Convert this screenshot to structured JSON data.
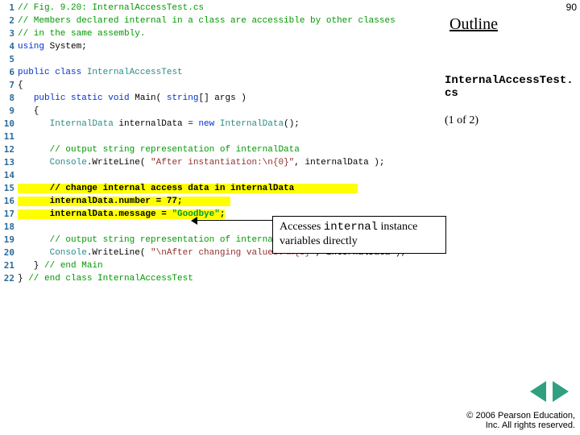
{
  "slide": {
    "page_number": "90",
    "outline_label": "Outline",
    "file_label_line1": "InternalAccessTest.",
    "file_label_line2": "cs",
    "page_indicator": "(1 of 2)"
  },
  "code": [
    {
      "n": "1",
      "segs": [
        {
          "c": "tok-comment",
          "t": "// Fig. 9.20: InternalAccessTest.cs"
        }
      ]
    },
    {
      "n": "2",
      "segs": [
        {
          "c": "tok-comment",
          "t": "// Members declared internal in a class are accessible by other classes "
        }
      ]
    },
    {
      "n": "3",
      "segs": [
        {
          "c": "tok-comment",
          "t": "// in the same assembly."
        }
      ]
    },
    {
      "n": "4",
      "segs": [
        {
          "c": "tok-key",
          "t": "using"
        },
        {
          "c": "tok-norm",
          "t": " System;"
        }
      ]
    },
    {
      "n": "5",
      "segs": []
    },
    {
      "n": "6",
      "segs": [
        {
          "c": "tok-key",
          "t": "public class"
        },
        {
          "c": "tok-norm",
          "t": " "
        },
        {
          "c": "tok-type",
          "t": "InternalAccessTest"
        }
      ]
    },
    {
      "n": "7",
      "segs": [
        {
          "c": "tok-norm",
          "t": "{"
        }
      ]
    },
    {
      "n": "8",
      "segs": [
        {
          "c": "tok-norm",
          "t": "   "
        },
        {
          "c": "tok-key",
          "t": "public static void"
        },
        {
          "c": "tok-norm",
          "t": " Main( "
        },
        {
          "c": "tok-key",
          "t": "string"
        },
        {
          "c": "tok-norm",
          "t": "[] args )"
        }
      ]
    },
    {
      "n": "9",
      "segs": [
        {
          "c": "tok-norm",
          "t": "   {"
        }
      ]
    },
    {
      "n": "10",
      "segs": [
        {
          "c": "tok-norm",
          "t": "      "
        },
        {
          "c": "tok-type",
          "t": "InternalData"
        },
        {
          "c": "tok-norm",
          "t": " internalData = "
        },
        {
          "c": "tok-key",
          "t": "new"
        },
        {
          "c": "tok-norm",
          "t": " "
        },
        {
          "c": "tok-type",
          "t": "InternalData"
        },
        {
          "c": "tok-norm",
          "t": "();"
        }
      ]
    },
    {
      "n": "11",
      "segs": []
    },
    {
      "n": "12",
      "segs": [
        {
          "c": "tok-norm",
          "t": "      "
        },
        {
          "c": "tok-comment",
          "t": "// output string representation of internalData"
        }
      ]
    },
    {
      "n": "13",
      "segs": [
        {
          "c": "tok-norm",
          "t": "      "
        },
        {
          "c": "tok-type",
          "t": "Console"
        },
        {
          "c": "tok-norm",
          "t": ".WriteLine( "
        },
        {
          "c": "tok-str",
          "t": "\"After instantiation:\\n{0}\""
        },
        {
          "c": "tok-norm",
          "t": ", internalData );"
        }
      ]
    },
    {
      "n": "14",
      "segs": []
    },
    {
      "n": "15",
      "hl": true,
      "segs": [
        {
          "c": "tok-norm",
          "t": "      // change internal access data in internalData            "
        }
      ]
    },
    {
      "n": "16",
      "hl": true,
      "segs": [
        {
          "c": "tok-norm",
          "t": "      internalData.number = 77;         "
        }
      ]
    },
    {
      "n": "17",
      "hl": true,
      "segs": [
        {
          "c": "tok-norm",
          "t": "      internalData.message = "
        },
        {
          "c": "tok-str",
          "t": "\"Goodbye\""
        },
        {
          "c": "tok-norm",
          "t": ";"
        }
      ]
    },
    {
      "n": "18",
      "segs": []
    },
    {
      "n": "19",
      "segs": [
        {
          "c": "tok-norm",
          "t": "      "
        },
        {
          "c": "tok-comment",
          "t": "// output string representation of internalData"
        }
      ]
    },
    {
      "n": "20",
      "segs": [
        {
          "c": "tok-norm",
          "t": "      "
        },
        {
          "c": "tok-type",
          "t": "Console"
        },
        {
          "c": "tok-norm",
          "t": ".WriteLine( "
        },
        {
          "c": "tok-str",
          "t": "\"\\nAfter changing values:\\n{0}\""
        },
        {
          "c": "tok-norm",
          "t": ", internalData );"
        }
      ]
    },
    {
      "n": "21",
      "segs": [
        {
          "c": "tok-norm",
          "t": "   } "
        },
        {
          "c": "tok-comment",
          "t": "// end Main"
        }
      ]
    },
    {
      "n": "22",
      "segs": [
        {
          "c": "tok-norm",
          "t": "} "
        },
        {
          "c": "tok-comment",
          "t": "// end class InternalAccessTest"
        }
      ]
    }
  ],
  "callout": {
    "pre": "Accesses ",
    "code": "internal",
    "post": " instance variables directly"
  },
  "footer": {
    "line1": "© 2006 Pearson Education,",
    "line2": "Inc.  All rights reserved."
  }
}
